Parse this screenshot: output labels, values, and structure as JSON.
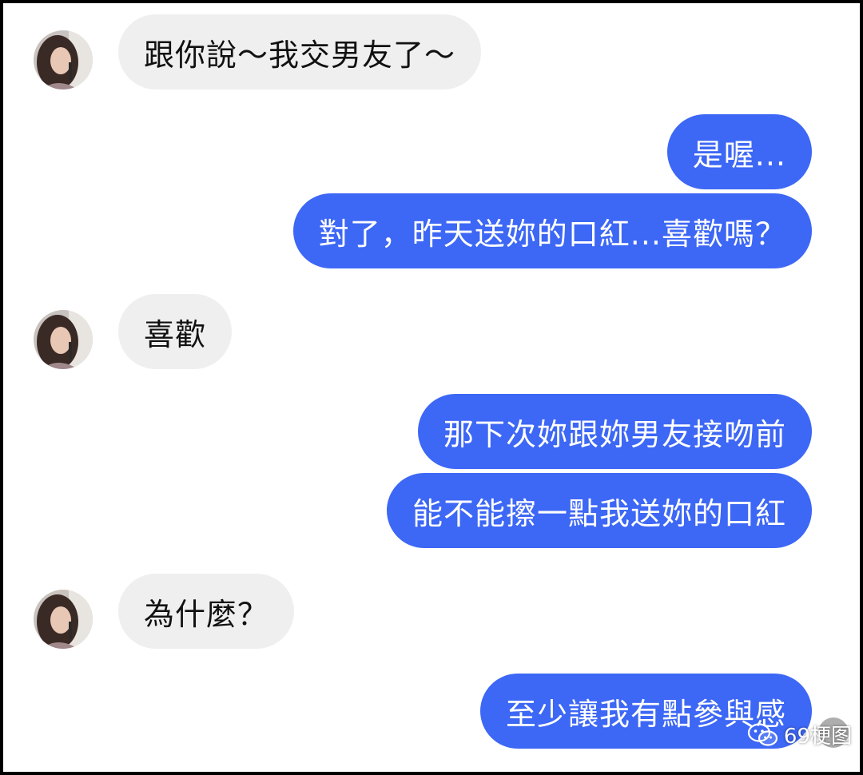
{
  "conversation": {
    "messages": [
      {
        "side": "incoming",
        "text": "跟你說～我交男友了～"
      },
      {
        "side": "outgoing",
        "text": "是喔..."
      },
      {
        "side": "outgoing",
        "text": "對了，昨天送妳的口紅...喜歡嗎？"
      },
      {
        "side": "incoming",
        "text": "喜歡"
      },
      {
        "side": "outgoing",
        "text": "那下次妳跟妳男友接吻前"
      },
      {
        "side": "outgoing",
        "text": "能不能擦一點我送妳的口紅"
      },
      {
        "side": "incoming",
        "text": "為什麼？"
      },
      {
        "side": "outgoing",
        "text": "至少讓我有點參與感"
      }
    ]
  },
  "watermark": {
    "text": "69梗图",
    "icon": "wechat-icon"
  },
  "colors": {
    "outgoing_bubble": "#3d67f5",
    "incoming_bubble": "#efefef",
    "outgoing_text": "#ffffff",
    "incoming_text": "#111111"
  }
}
